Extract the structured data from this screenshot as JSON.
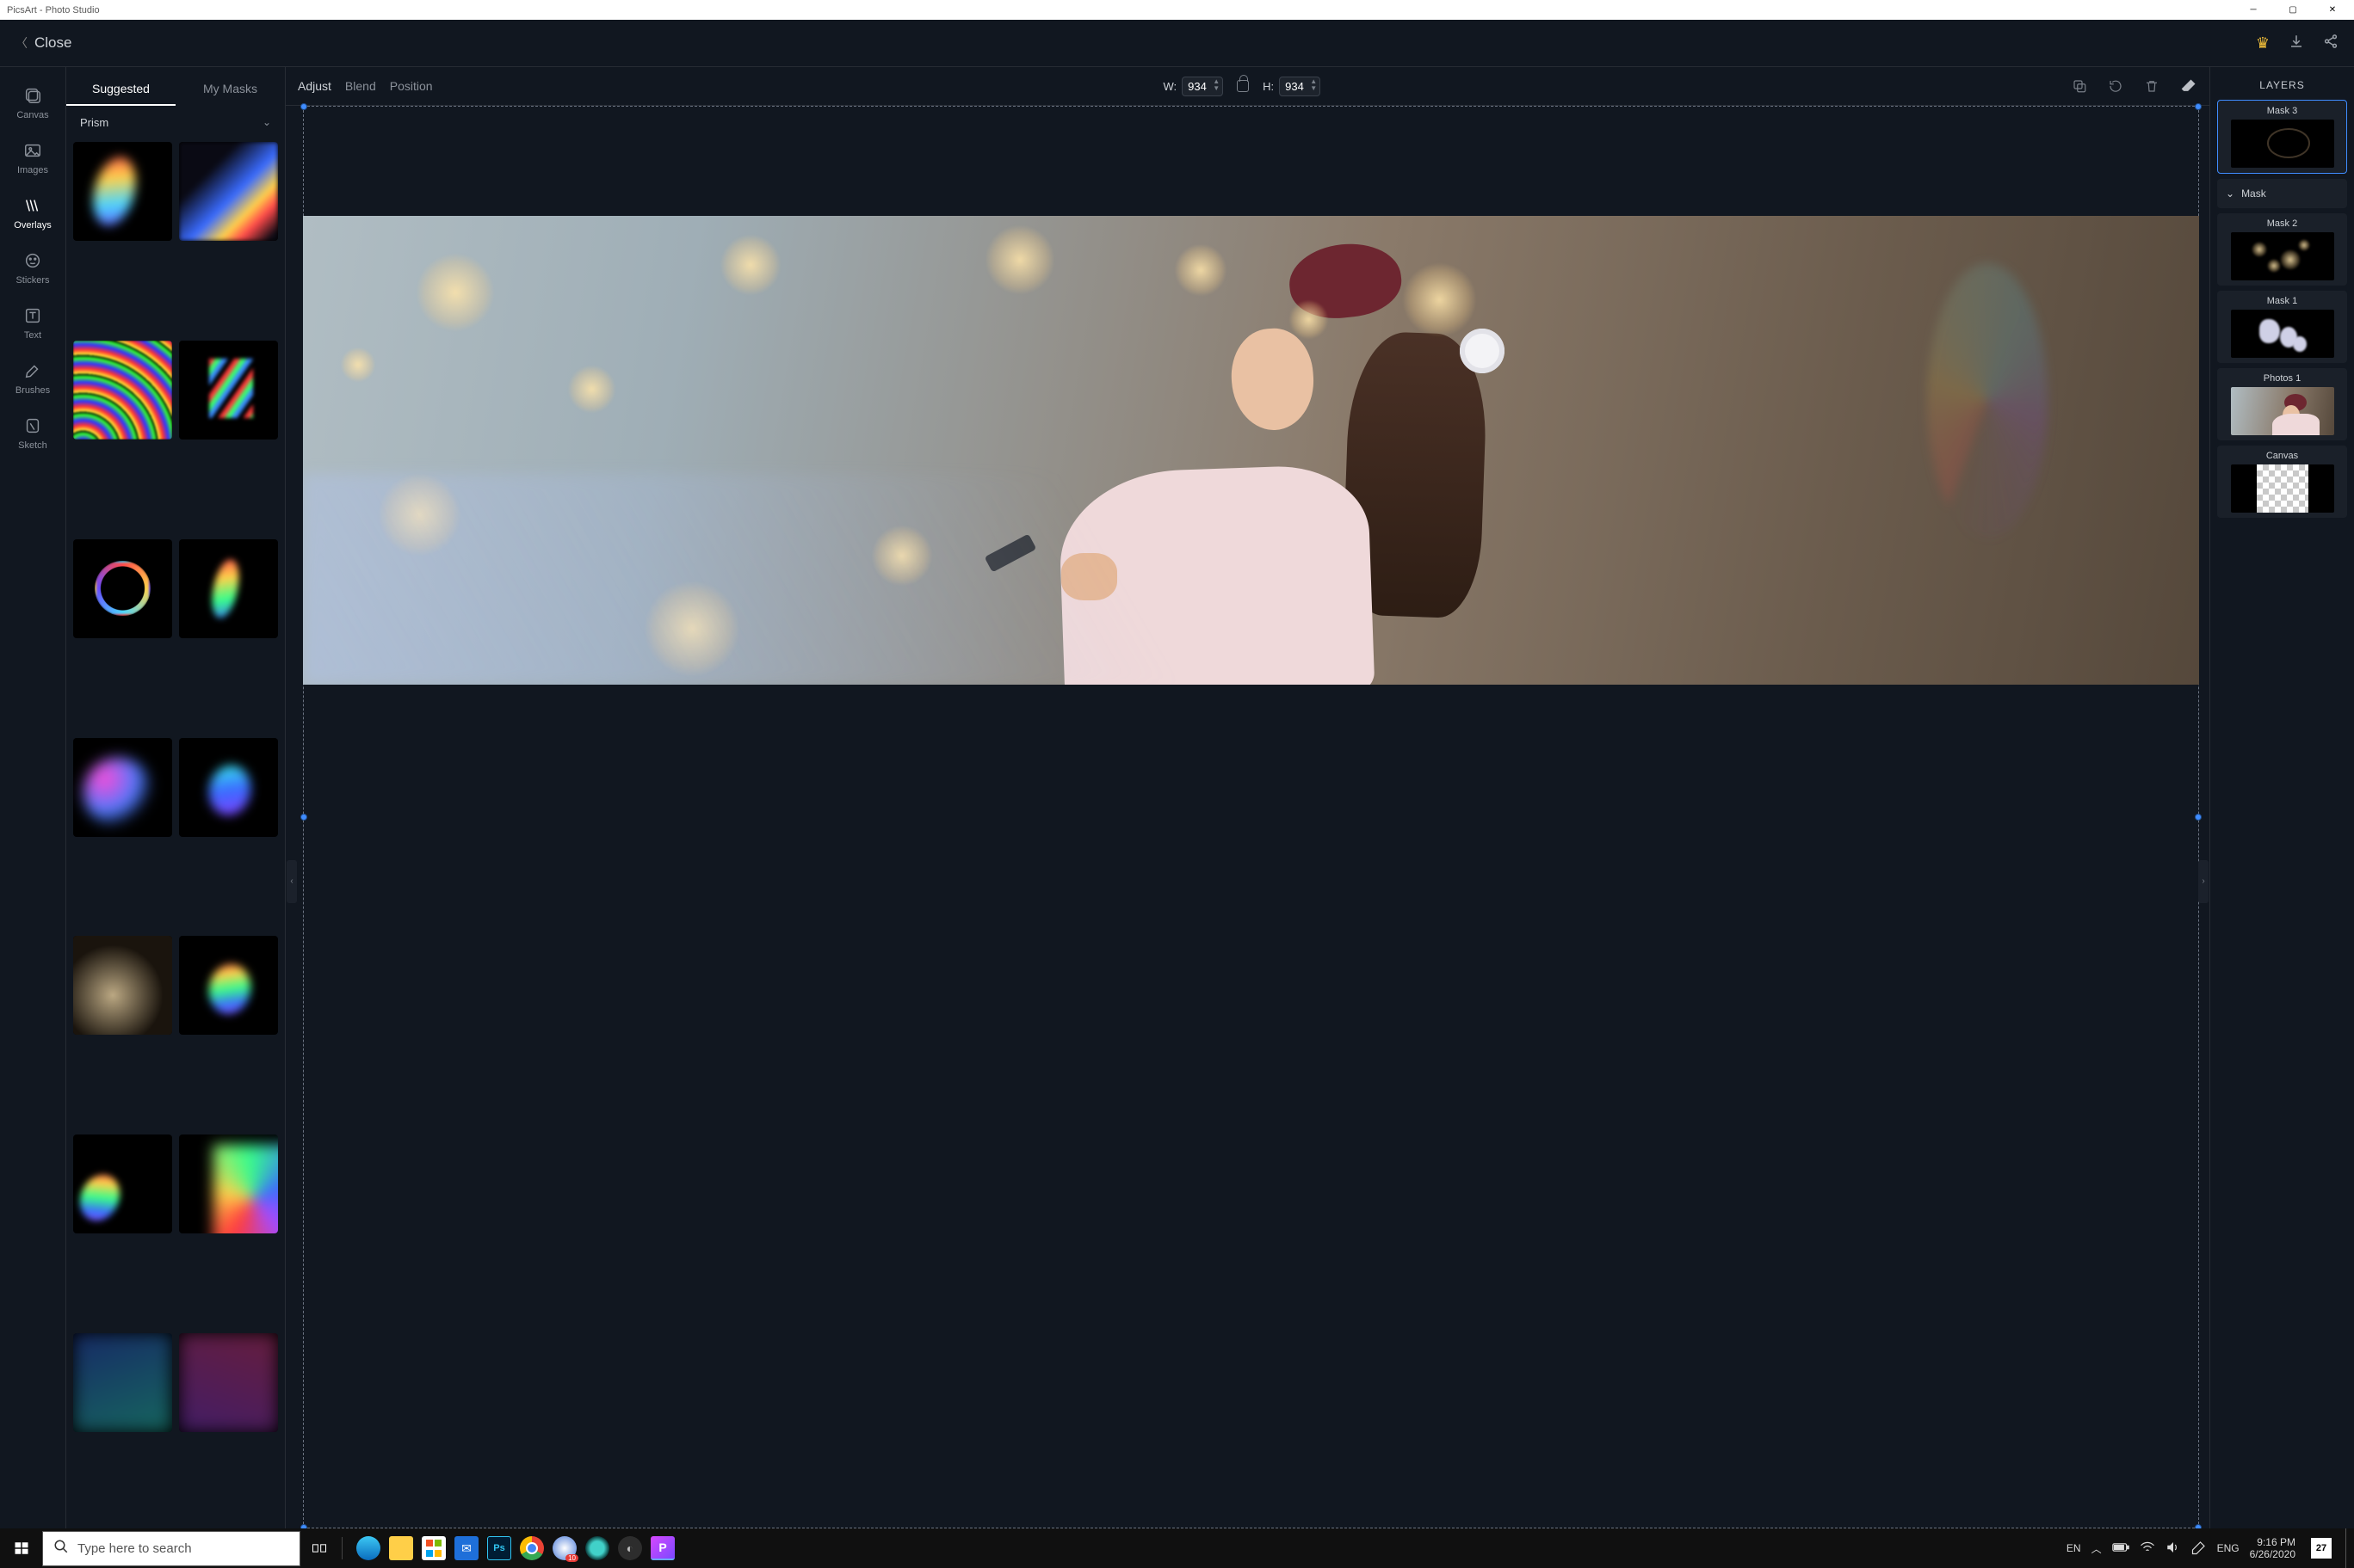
{
  "window": {
    "title": "PicsArt - Photo Studio"
  },
  "header": {
    "close": "Close"
  },
  "leftRail": [
    {
      "key": "canvas",
      "label": "Canvas"
    },
    {
      "key": "images",
      "label": "Images"
    },
    {
      "key": "overlays",
      "label": "Overlays"
    },
    {
      "key": "stickers",
      "label": "Stickers"
    },
    {
      "key": "text",
      "label": "Text"
    },
    {
      "key": "brushes",
      "label": "Brushes"
    },
    {
      "key": "sketch",
      "label": "Sketch"
    }
  ],
  "leftPanel": {
    "tabs": {
      "suggested": "Suggested",
      "mymasks": "My Masks"
    },
    "category": "Prism"
  },
  "canvasToolbar": {
    "adjust": "Adjust",
    "blend": "Blend",
    "position": "Position",
    "wLabel": "W:",
    "hLabel": "H:",
    "width": "934",
    "height": "934"
  },
  "rightPanel": {
    "title": "LAYERS",
    "maskGroup": "Mask",
    "layers": [
      {
        "name": "Mask 3"
      },
      {
        "name": "Mask 2"
      },
      {
        "name": "Mask 1"
      },
      {
        "name": "Photos 1"
      },
      {
        "name": "Canvas"
      }
    ]
  },
  "taskbar": {
    "searchPlaceholder": "Type here to search",
    "lang1": "EN",
    "lang2": "ENG",
    "time": "9:16 PM",
    "date": "6/26/2020",
    "calendarDay": "27"
  }
}
